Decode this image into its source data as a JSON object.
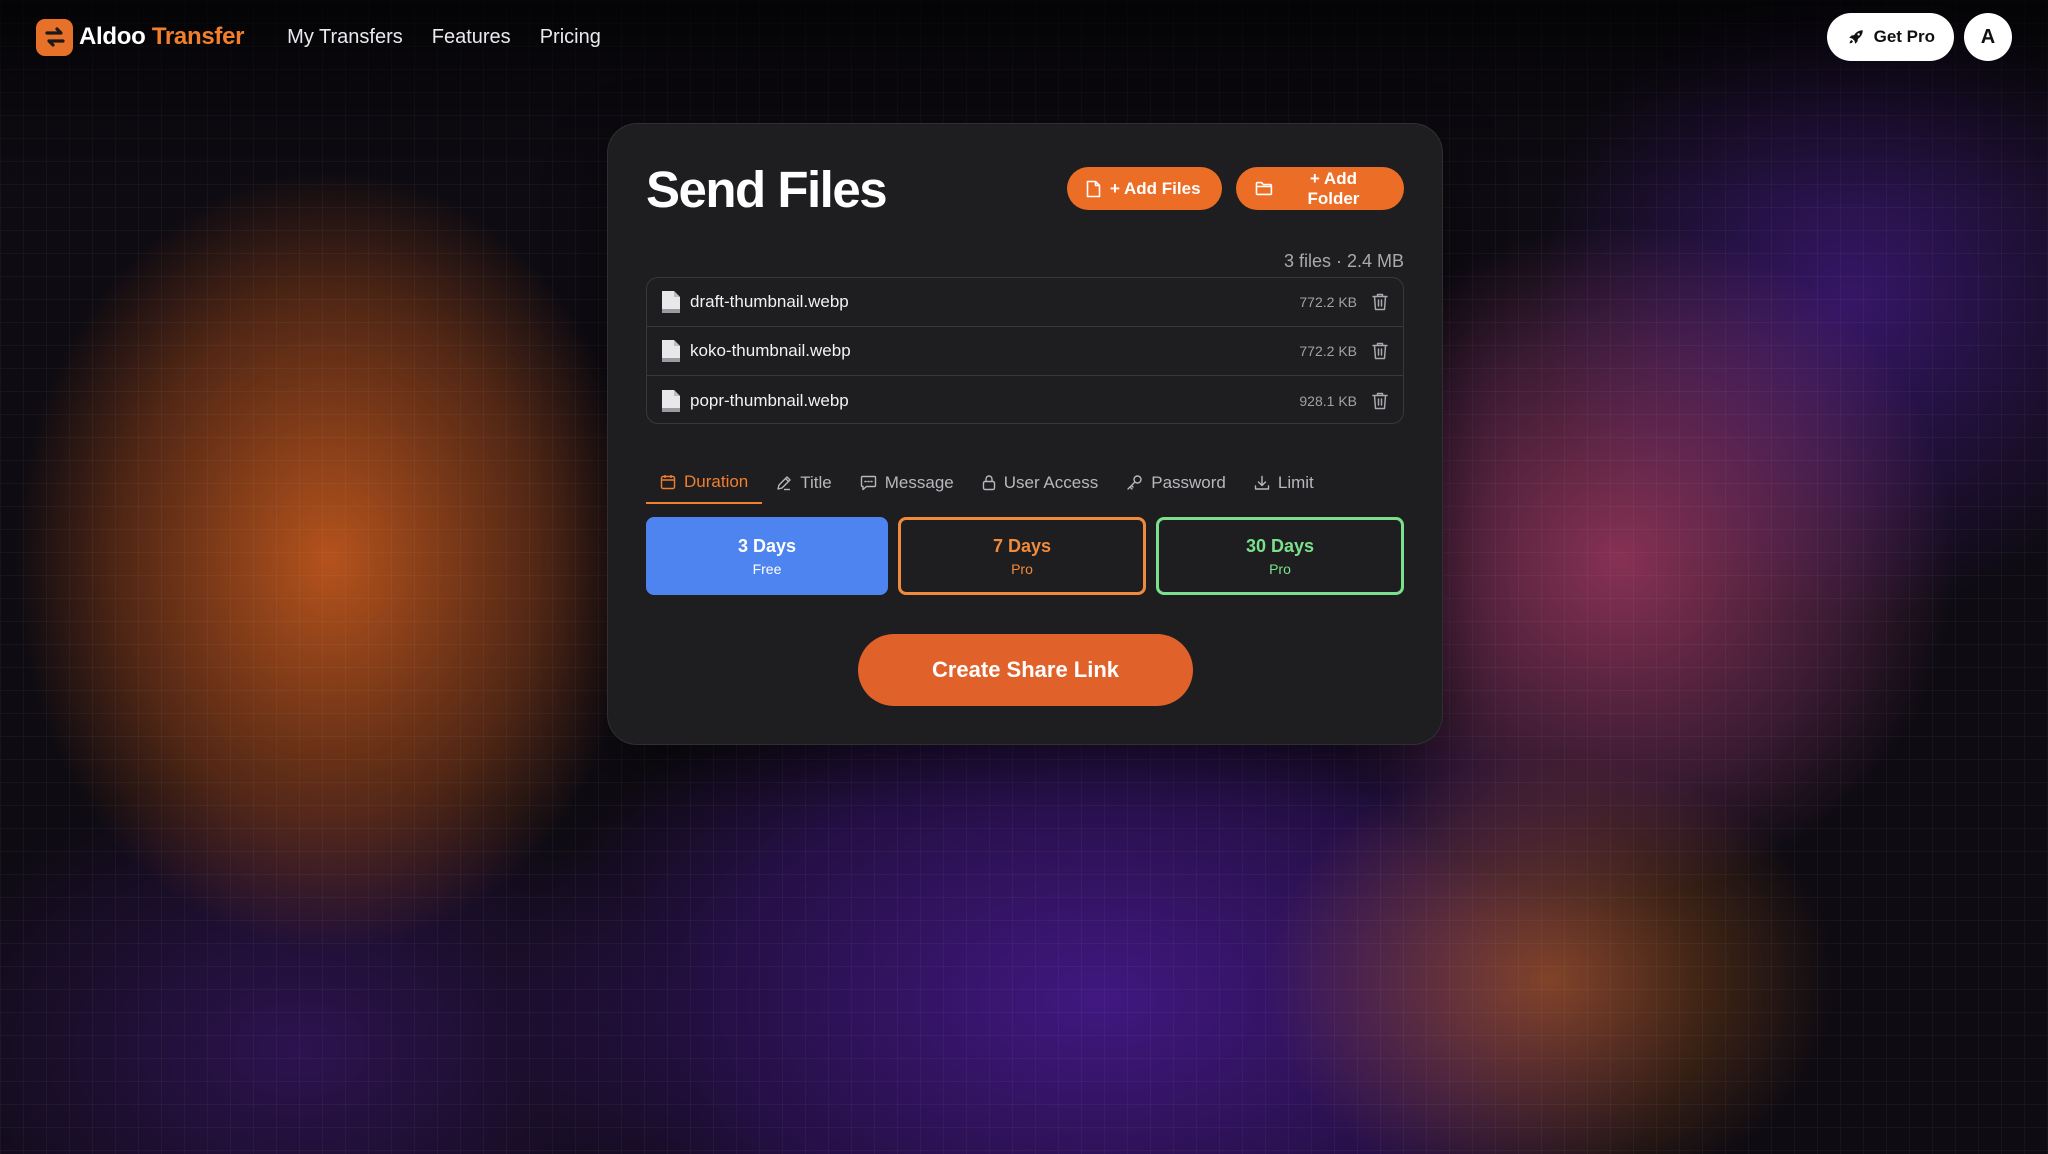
{
  "header": {
    "brand_primary": "Aldoo",
    "brand_secondary": "Transfer",
    "nav": [
      "My Transfers",
      "Features",
      "Pricing"
    ],
    "get_pro_label": "Get Pro",
    "avatar_initial": "A"
  },
  "card": {
    "title": "Send Files",
    "add_files_label": "+ Add Files",
    "add_folder_label": "+ Add Folder",
    "summary": "3 files · 2.4 MB",
    "files": [
      {
        "name": "draft-thumbnail.webp",
        "size": "772.2 KB"
      },
      {
        "name": "koko-thumbnail.webp",
        "size": "772.2 KB"
      },
      {
        "name": "popr-thumbnail.webp",
        "size": "928.1 KB"
      }
    ],
    "tabs": [
      {
        "label": "Duration",
        "icon": "calendar-icon",
        "active": true
      },
      {
        "label": "Title",
        "icon": "edit-icon",
        "active": false
      },
      {
        "label": "Message",
        "icon": "message-icon",
        "active": false
      },
      {
        "label": "User Access",
        "icon": "lock-icon",
        "active": false
      },
      {
        "label": "Password",
        "icon": "key-icon",
        "active": false
      },
      {
        "label": "Limit",
        "icon": "download-icon",
        "active": false
      }
    ],
    "durations": [
      {
        "label": "3 Days",
        "tier": "Free"
      },
      {
        "label": "7 Days",
        "tier": "Pro"
      },
      {
        "label": "30 Days",
        "tier": "Pro"
      }
    ],
    "create_label": "Create Share Link"
  },
  "colors": {
    "accent": "#ec6d25",
    "selected_duration": "#4d84ef",
    "pro_orange": "#f08a3c",
    "pro_green": "#7be08c"
  }
}
